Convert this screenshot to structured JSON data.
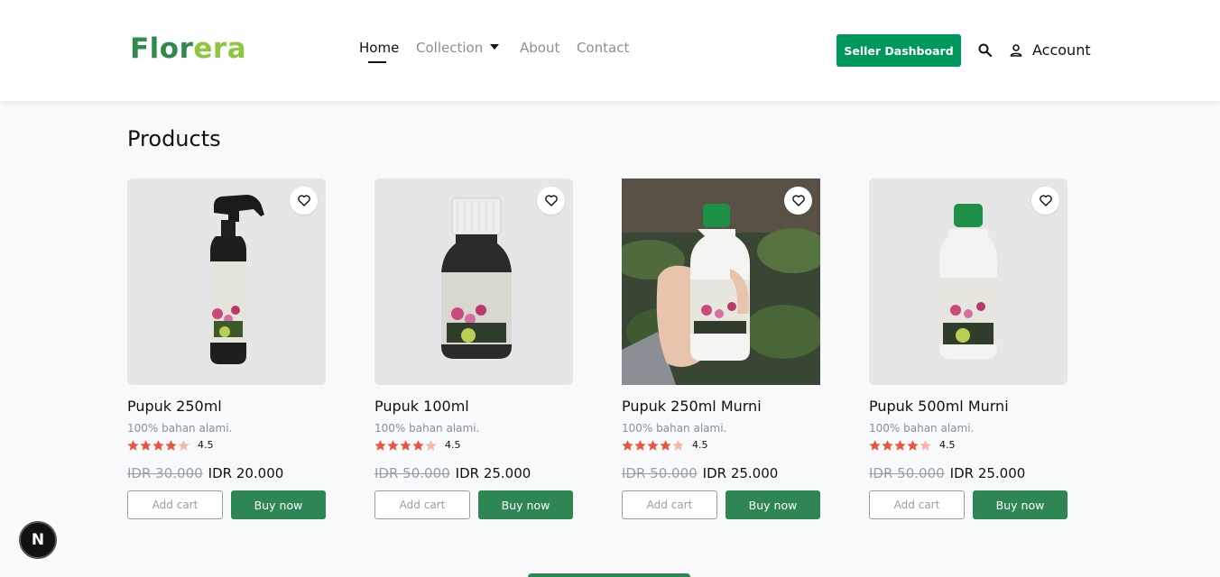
{
  "brand": {
    "part1": "Flor",
    "part2": "era"
  },
  "nav": {
    "home": "Home",
    "collection": "Collection",
    "about": "About",
    "contact": "Contact"
  },
  "header": {
    "seller_button": "Seller Dashboard",
    "account_label": "Account"
  },
  "main": {
    "title": "Products"
  },
  "products": [
    {
      "name": "Pupuk 250ml",
      "desc": "100% bahan alami.",
      "rating": "4.5",
      "old_price": "IDR 30.000",
      "price": "IDR 20.000",
      "add_label": "Add cart",
      "buy_label": "Buy now"
    },
    {
      "name": "Pupuk 100ml",
      "desc": "100% bahan alami.",
      "rating": "4.5",
      "old_price": "IDR 50.000",
      "price": "IDR 25.000",
      "add_label": "Add cart",
      "buy_label": "Buy now"
    },
    {
      "name": "Pupuk 250ml Murni",
      "desc": "100% bahan alami.",
      "rating": "4.5",
      "old_price": "IDR 50.000",
      "price": "IDR 25.000",
      "add_label": "Add cart",
      "buy_label": "Buy now"
    },
    {
      "name": "Pupuk 500ml Murni",
      "desc": "100% bahan alami.",
      "rating": "4.5",
      "old_price": "IDR 50.000",
      "price": "IDR 25.000",
      "add_label": "Add cart",
      "buy_label": "Buy now"
    }
  ],
  "badge": {
    "letter": "N"
  },
  "colors": {
    "brand_green": "#2f8a4c",
    "brand_lime": "#8dc63f",
    "seller_green": "#00975d",
    "buy_green": "#2e8655",
    "star": "#e8553e"
  }
}
